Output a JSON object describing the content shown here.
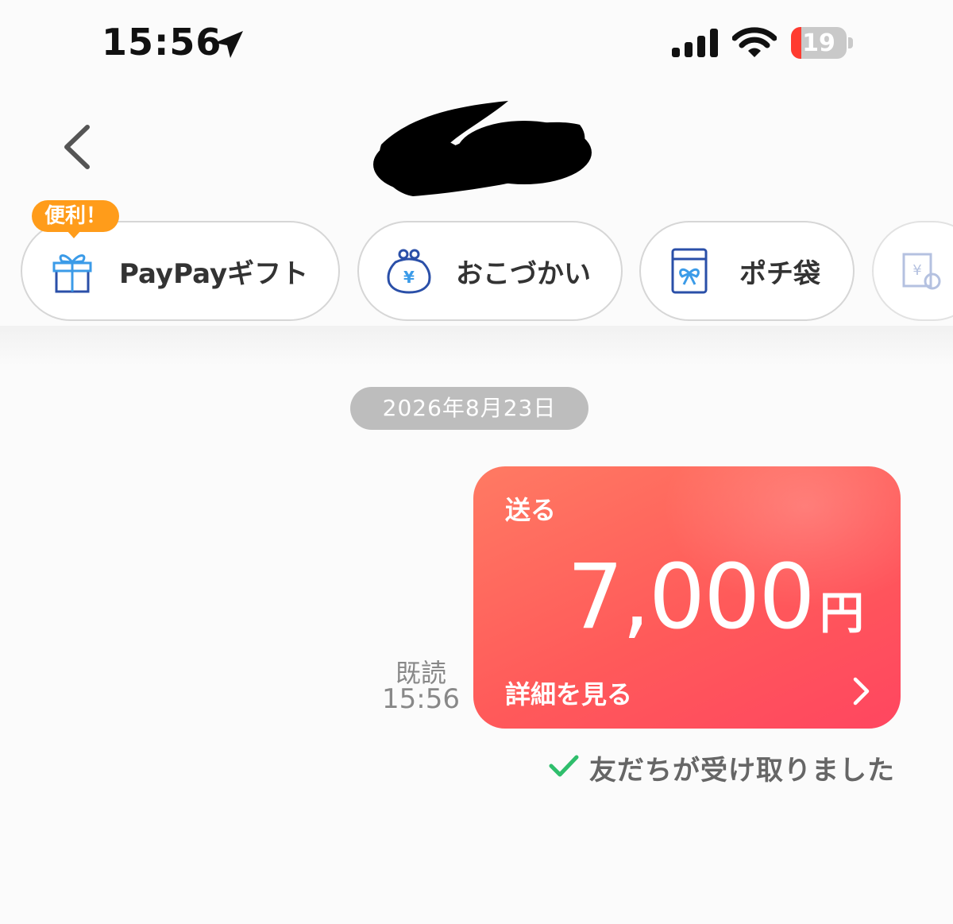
{
  "status_bar": {
    "time": "15:56",
    "battery": "19",
    "battery_level": 0.19
  },
  "quick_actions": {
    "badge": "便利！",
    "items": [
      {
        "label": "PayPayギフト",
        "icon": "gift-icon"
      },
      {
        "label": "おこづかい",
        "icon": "coin-purse-icon"
      },
      {
        "label": "ポチ袋",
        "icon": "envelope-icon"
      },
      {
        "label": "",
        "icon": "yen-document-icon"
      }
    ]
  },
  "chat": {
    "date": "2026年8月23日",
    "read_label": "既読",
    "read_time": "15:56",
    "payment": {
      "type": "送る",
      "amount": "7,000",
      "currency": "円",
      "details_label": "詳細を見る"
    },
    "status_text": "友だちが受け取りました"
  },
  "colors": {
    "card_red": "#ff5a5a",
    "badge_orange": "#ff9c1a",
    "check_green": "#2fbe6c",
    "icon_blue": "#2a4fa8"
  }
}
